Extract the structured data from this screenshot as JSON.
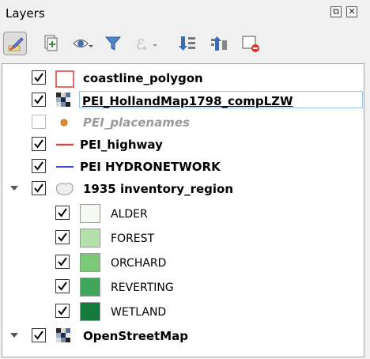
{
  "panel": {
    "title": "Layers"
  },
  "window_buttons": [
    {
      "name": "float-panel-icon",
      "glyph": "⧉"
    },
    {
      "name": "close-panel-icon",
      "glyph": "✕"
    }
  ],
  "toolbar": [
    {
      "name": "style-panel-button",
      "icon": "paintbrush-icon",
      "active": true
    },
    {
      "name": "add-group-button",
      "icon": "add-group-icon"
    },
    {
      "name": "visibility-menu-button",
      "icon": "eye-icon"
    },
    {
      "name": "filter-legend-button",
      "icon": "funnel-icon"
    },
    {
      "name": "filter-expression-button",
      "icon": "epsilon-icon",
      "disabled": true
    },
    {
      "name": "expand-all-button",
      "icon": "expand-all-icon"
    },
    {
      "name": "collapse-all-button",
      "icon": "collapse-all-icon"
    },
    {
      "name": "remove-layer-button",
      "icon": "remove-layer-icon"
    }
  ],
  "layers": [
    {
      "label": "coastline_polygon",
      "checked": true,
      "symbol": "polygon-outline",
      "color": "#e0393a",
      "style": "bold"
    },
    {
      "label": "PEI_HollandMap1798_compLZW",
      "checked": true,
      "symbol": "raster",
      "style": "bold",
      "selected": true
    },
    {
      "label": "PEI_placenames",
      "checked": false,
      "symbol": "point",
      "color": "#e08a2c",
      "style": "italic-grey"
    },
    {
      "label": "PEI_highway",
      "checked": true,
      "symbol": "line",
      "color": "#c5504f",
      "style": "bold"
    },
    {
      "label": "PEI HYDRONETWORK",
      "checked": true,
      "symbol": "line",
      "color": "#3d4fd6",
      "style": "bold"
    },
    {
      "label": "1935 inventory_region",
      "checked": true,
      "symbol": "polygon-group",
      "style": "bold",
      "expanded": true,
      "classes": [
        {
          "label": "ALDER",
          "checked": true,
          "color": "#f4faf1"
        },
        {
          "label": "FOREST",
          "checked": true,
          "color": "#b5e0ac"
        },
        {
          "label": "ORCHARD",
          "checked": true,
          "color": "#7cc879"
        },
        {
          "label": "REVERTING",
          "checked": true,
          "color": "#3ea55a"
        },
        {
          "label": "WETLAND",
          "checked": true,
          "color": "#137a3c"
        }
      ]
    },
    {
      "label": "OpenStreetMap",
      "checked": true,
      "symbol": "raster",
      "style": "bold",
      "expanded": true
    }
  ]
}
